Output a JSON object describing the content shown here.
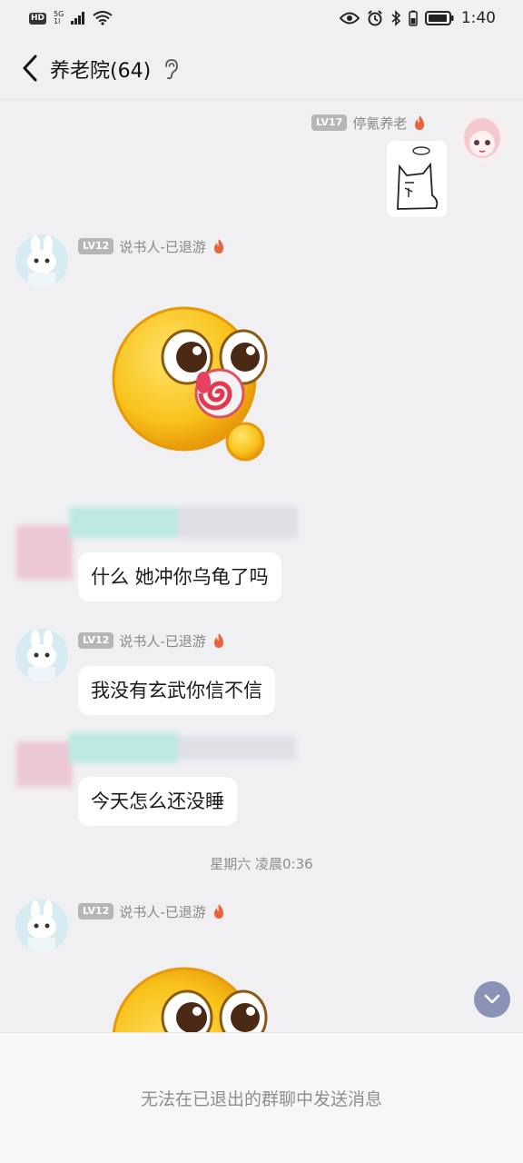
{
  "status_bar": {
    "hd": "HD",
    "network_top": "5G",
    "network_bottom": "1l",
    "time": "1:40"
  },
  "header": {
    "title": "养老院(64)"
  },
  "messages": [
    {
      "side": "right",
      "level": "LV17",
      "nickname": "停氪养老",
      "content_type": "sticker"
    },
    {
      "side": "left",
      "level": "LV12",
      "nickname": "说书人-已退游",
      "content_type": "emoji-lollipop"
    },
    {
      "side": "left",
      "content_type": "text",
      "text": "什么 她冲你乌龟了吗"
    },
    {
      "side": "left",
      "level": "LV12",
      "nickname": "说书人-已退游",
      "content_type": "text",
      "text": "我没有玄武你信不信"
    },
    {
      "side": "left",
      "content_type": "text",
      "text": "今天怎么还没睡"
    },
    {
      "side": "left",
      "level": "LV12",
      "nickname": "说书人-已退游",
      "content_type": "emoji-lollipop"
    }
  ],
  "timestamp": "星期六 凌晨0:36",
  "footer": {
    "notice": "无法在已退出的群聊中发送消息"
  },
  "icons": [
    "back-icon",
    "ear-icon",
    "flame-icon",
    "chevron-down-icon",
    "eye-icon",
    "alarm-icon",
    "bluetooth-icon",
    "battery-icon",
    "wifi-icon",
    "signal-icon"
  ],
  "colors": {
    "background": "#f0f0f3",
    "bubble": "#ffffff",
    "level_badge": "#b5b5ba",
    "flame": "#e8643c",
    "scroll_button": "#8a93b5"
  }
}
